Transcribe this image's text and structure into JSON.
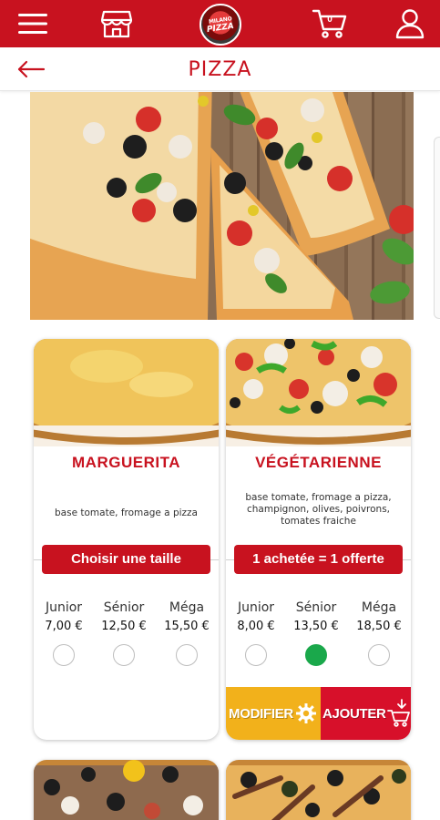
{
  "header": {
    "cart_count": "0",
    "logo_line1": "MILANO",
    "logo_line2": "PIZZA"
  },
  "page": {
    "title": "PIZZA"
  },
  "products": [
    {
      "name": "MARGUERITA",
      "description": "base tomate, fromage a pizza",
      "action_label": "Choisir une taille",
      "sizes": [
        {
          "label": "Junior",
          "price": "7,00 €",
          "selected": false
        },
        {
          "label": "Sénior",
          "price": "12,50 €",
          "selected": false
        },
        {
          "label": "Méga",
          "price": "15,50 €",
          "selected": false
        }
      ]
    },
    {
      "name": "VÉGÉTARIENNE",
      "description": "base tomate, fromage a pizza, champignon, olives, poivrons, tomates fraiche",
      "action_label": "1 achetée = 1 offerte",
      "sizes": [
        {
          "label": "Junior",
          "price": "8,00 €",
          "selected": false
        },
        {
          "label": "Sénior",
          "price": "13,50 €",
          "selected": true
        },
        {
          "label": "Méga",
          "price": "18,50 €",
          "selected": false
        }
      ],
      "modify_label": "MODIFIER",
      "add_label": "AJOUTER"
    }
  ],
  "colors": {
    "brand_red": "#c8121f",
    "modify_yellow": "#f2b11b",
    "add_red": "#d7102a",
    "selected_green": "#1aa84b"
  },
  "icons": {
    "menu": "hamburger-icon",
    "store": "store-icon",
    "cart": "cart-icon",
    "user": "user-icon",
    "back": "arrow-left-icon",
    "gear": "gear-icon",
    "add_cart": "cart-download-icon"
  }
}
